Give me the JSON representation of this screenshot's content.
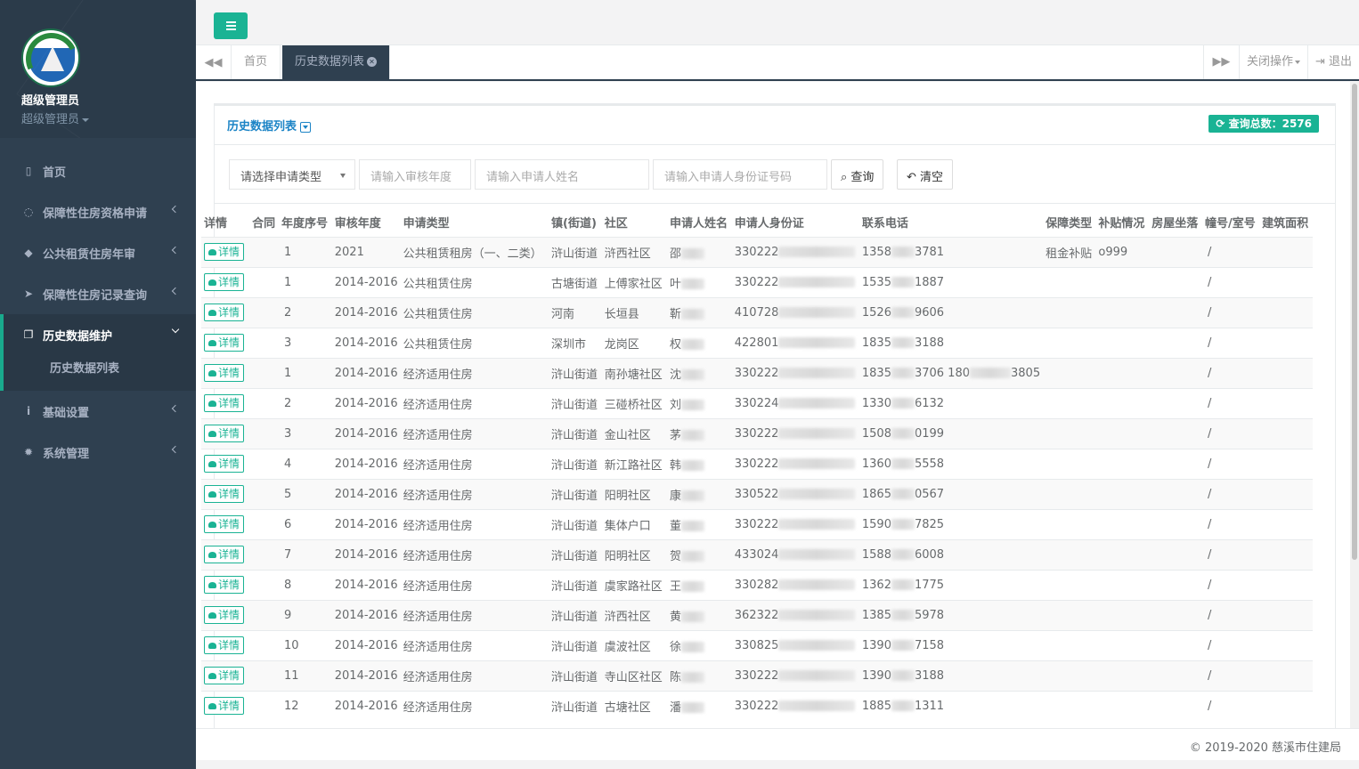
{
  "profile": {
    "name": "超级管理员",
    "role": "超级管理员"
  },
  "nav": [
    {
      "icon": "columns-icon",
      "glyph": "▯",
      "label": "首页"
    },
    {
      "icon": "comment-icon",
      "glyph": "◌",
      "label": "保障性住房资格申请"
    },
    {
      "icon": "tag-icon",
      "glyph": "◆",
      "label": "公共租赁住房年审"
    },
    {
      "icon": "paper-plane-icon",
      "glyph": "➤",
      "label": "保障性住房记录查询"
    },
    {
      "icon": "copy-icon",
      "glyph": "❐",
      "label": "历史数据维护",
      "sub": "历史数据列表"
    },
    {
      "icon": "info-icon",
      "glyph": "i",
      "label": "基础设置"
    },
    {
      "icon": "gear-icon",
      "glyph": "✹",
      "label": "系统管理"
    }
  ],
  "tabs": {
    "home": "首页",
    "active": "历史数据列表"
  },
  "tools": {
    "close_ops": "关闭操作",
    "logout": "退出"
  },
  "panel": {
    "title": "历史数据列表",
    "total": "查询总数：2576"
  },
  "filter": {
    "select": "请选择申请类型",
    "year_placeholder": "请输入审核年度",
    "name_placeholder": "请输入申请人姓名",
    "id_placeholder": "请输入申请人身份证号码",
    "search": "查询",
    "clear": "清空"
  },
  "table": {
    "columns": [
      "详情",
      "合同",
      "年度序号",
      "审核年度",
      "申请类型",
      "镇(街道)",
      "社区",
      "申请人姓名",
      "申请人身份证",
      "联系电话",
      "保障类型",
      "补贴情况",
      "房屋坐落",
      "幢号/室号",
      "建筑面积"
    ],
    "detail_label": "详情",
    "rows": [
      {
        "seq": "1",
        "year": "2021",
        "type": "公共租赁租房（一、二类）",
        "town": "浒山街道",
        "community": "浒西社区",
        "name": "邵",
        "id": "330222",
        "phone": "1358",
        "phone_end": "3781",
        "guarantee": "租金补贴",
        "subsidy": "o999",
        "room": "/"
      },
      {
        "seq": "1",
        "year": "2014-2016",
        "type": "公共租赁住房",
        "town": "古塘街道",
        "community": "上傅家社区",
        "name": "叶",
        "id": "330222",
        "phone": "1535",
        "phone_end": "1887",
        "guarantee": "",
        "subsidy": "",
        "room": "/"
      },
      {
        "seq": "2",
        "year": "2014-2016",
        "type": "公共租赁住房",
        "town": "河南",
        "community": "长垣县",
        "name": "靳",
        "id": "410728",
        "phone": "1526",
        "phone_end": "9606",
        "guarantee": "",
        "subsidy": "",
        "room": "/"
      },
      {
        "seq": "3",
        "year": "2014-2016",
        "type": "公共租赁住房",
        "town": "深圳市",
        "community": "龙岗区",
        "name": "权",
        "id": "422801",
        "phone": "1835",
        "phone_end": "3188",
        "guarantee": "",
        "subsidy": "",
        "room": "/"
      },
      {
        "seq": "1",
        "year": "2014-2016",
        "type": "经济适用住房",
        "town": "浒山街道",
        "community": "南孙塘社区",
        "name": "沈",
        "id": "330222",
        "phone": "1835",
        "phone_end": "3706 180",
        "phone_end2": "3805",
        "guarantee": "",
        "subsidy": "",
        "room": "/"
      },
      {
        "seq": "2",
        "year": "2014-2016",
        "type": "经济适用住房",
        "town": "浒山街道",
        "community": "三碰桥社区",
        "name": "刘",
        "id": "330224",
        "phone": "1330",
        "phone_end": "6132",
        "guarantee": "",
        "subsidy": "",
        "room": "/"
      },
      {
        "seq": "3",
        "year": "2014-2016",
        "type": "经济适用住房",
        "town": "浒山街道",
        "community": "金山社区",
        "name": "茅",
        "id": "330222",
        "phone": "1508",
        "phone_end": "0199",
        "guarantee": "",
        "subsidy": "",
        "room": "/"
      },
      {
        "seq": "4",
        "year": "2014-2016",
        "type": "经济适用住房",
        "town": "浒山街道",
        "community": "新江路社区",
        "name": "韩",
        "id": "330222",
        "phone": "1360",
        "phone_end": "5558",
        "guarantee": "",
        "subsidy": "",
        "room": "/"
      },
      {
        "seq": "5",
        "year": "2014-2016",
        "type": "经济适用住房",
        "town": "浒山街道",
        "community": "阳明社区",
        "name": "康",
        "id": "330522",
        "phone": "1865",
        "phone_end": "0567",
        "guarantee": "",
        "subsidy": "",
        "room": "/"
      },
      {
        "seq": "6",
        "year": "2014-2016",
        "type": "经济适用住房",
        "town": "浒山街道",
        "community": "集体户口",
        "name": "董",
        "id": "330222",
        "phone": "1590",
        "phone_end": "7825",
        "guarantee": "",
        "subsidy": "",
        "room": "/"
      },
      {
        "seq": "7",
        "year": "2014-2016",
        "type": "经济适用住房",
        "town": "浒山街道",
        "community": "阳明社区",
        "name": "贺",
        "id": "433024",
        "phone": "1588",
        "phone_end": "6008",
        "guarantee": "",
        "subsidy": "",
        "room": "/"
      },
      {
        "seq": "8",
        "year": "2014-2016",
        "type": "经济适用住房",
        "town": "浒山街道",
        "community": "虞家路社区",
        "name": "王",
        "id": "330282",
        "phone": "1362",
        "phone_end": "1775",
        "guarantee": "",
        "subsidy": "",
        "room": "/"
      },
      {
        "seq": "9",
        "year": "2014-2016",
        "type": "经济适用住房",
        "town": "浒山街道",
        "community": "浒西社区",
        "name": "黄",
        "id": "362322",
        "phone": "1385",
        "phone_end": "5978",
        "guarantee": "",
        "subsidy": "",
        "room": "/"
      },
      {
        "seq": "10",
        "year": "2014-2016",
        "type": "经济适用住房",
        "town": "浒山街道",
        "community": "虞波社区",
        "name": "徐",
        "id": "330825",
        "phone": "1390",
        "phone_end": "7158",
        "guarantee": "",
        "subsidy": "",
        "room": "/"
      },
      {
        "seq": "11",
        "year": "2014-2016",
        "type": "经济适用住房",
        "town": "浒山街道",
        "community": "寺山区社区",
        "name": "陈",
        "id": "330222",
        "phone": "1390",
        "phone_end": "3188",
        "guarantee": "",
        "subsidy": "",
        "room": "/"
      },
      {
        "seq": "12",
        "year": "2014-2016",
        "type": "经济适用住房",
        "town": "浒山街道",
        "community": "古塘社区",
        "name": "潘",
        "id": "330222",
        "phone": "1885",
        "phone_end": "1311",
        "guarantee": "",
        "subsidy": "",
        "room": "/"
      }
    ]
  },
  "footer": "© 2019-2020 慈溪市住建局",
  "colors": {
    "sidebar": "#2f4050",
    "accent": "#1ab394",
    "title_blue": "#1c84c6"
  }
}
